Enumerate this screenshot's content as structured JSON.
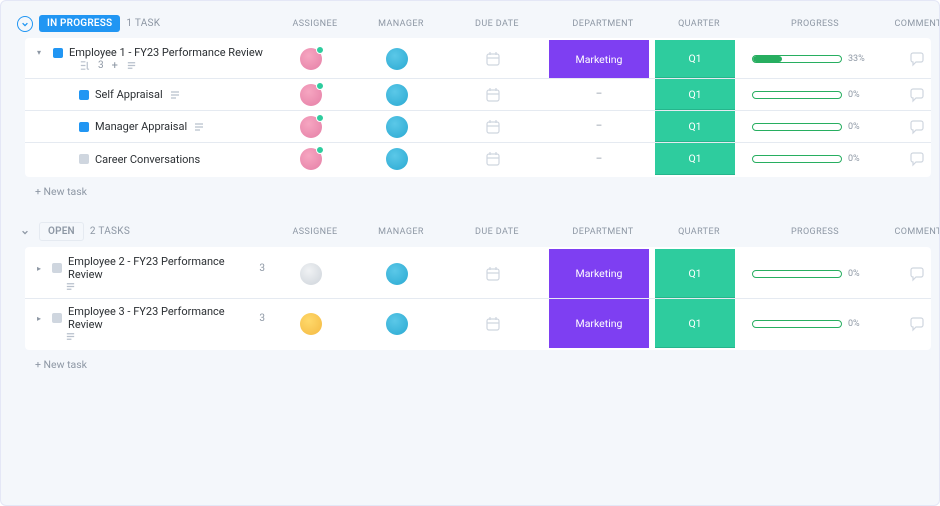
{
  "columns": {
    "assignee": "ASSIGNEE",
    "manager": "MANAGER",
    "due_date": "DUE DATE",
    "department": "DEPARTMENT",
    "quarter": "QUARTER",
    "progress": "PROGRESS",
    "comments": "COMMENTS"
  },
  "groups": [
    {
      "status_label": "IN PROGRESS",
      "status_style": "in_progress",
      "task_count_label": "1 TASK",
      "tasks": [
        {
          "title": "Employee 1 - FY23 Performance Review",
          "subtask_count": "3",
          "expanded": true,
          "assignee": "pink",
          "manager": "cyan",
          "department": "Marketing",
          "quarter": "Q1",
          "progress_pct": 33,
          "progress_label": "33%",
          "children": [
            {
              "title": "Self Appraisal",
              "assignee": "pink",
              "manager": "cyan",
              "department": "–",
              "quarter": "Q1",
              "progress_pct": 0,
              "progress_label": "0%"
            },
            {
              "title": "Manager Appraisal",
              "assignee": "pink",
              "manager": "cyan",
              "department": "–",
              "quarter": "Q1",
              "progress_pct": 0,
              "progress_label": "0%"
            },
            {
              "title": "Career Conversations",
              "assignee": "pink",
              "manager": "cyan",
              "department": "–",
              "quarter": "Q1",
              "progress_pct": 0,
              "progress_label": "0%"
            }
          ]
        }
      ],
      "new_task_label": "+ New task"
    },
    {
      "status_label": "OPEN",
      "status_style": "open",
      "task_count_label": "2 TASKS",
      "tasks": [
        {
          "title": "Employee 2 - FY23 Performance Review",
          "subtask_count": "3",
          "expanded": false,
          "assignee": "white",
          "manager": "cyan",
          "department": "Marketing",
          "quarter": "Q1",
          "progress_pct": 0,
          "progress_label": "0%"
        },
        {
          "title": "Employee 3 - FY23 Performance Review",
          "subtask_count": "3",
          "expanded": false,
          "assignee": "yellow",
          "manager": "cyan",
          "department": "Marketing",
          "quarter": "Q1",
          "progress_pct": 0,
          "progress_label": "0%"
        }
      ],
      "new_task_label": "+ New task"
    }
  ]
}
